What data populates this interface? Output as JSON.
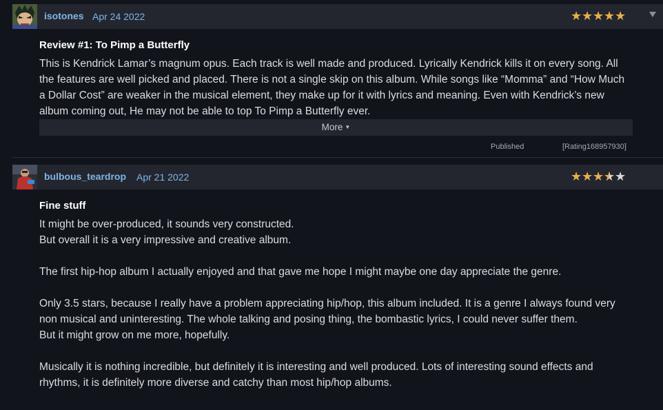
{
  "colors": {
    "background": "#12141c",
    "header_bar": "#23262f",
    "username": "#7fb5e6",
    "star_filled": "#e8b04a",
    "star_empty": "#d8d8d8"
  },
  "reviews": [
    {
      "username": "isotones",
      "date": "Apr 24 2022",
      "rating": 5,
      "stars": [
        "full",
        "full",
        "full",
        "full",
        "full"
      ],
      "title": "Review #1: To Pimp a Butterfly",
      "paragraphs": [
        "This is Kendrick Lamar’s magnum opus. Each track is well made and produced. Lyrically Kendrick kills it on every song. All the features are well picked and placed. There is not a single skip on this album. While songs like “Momma” and “How Much a Dollar Cost” are weaker in the musical element, they make up for it with lyrics and meaning. Even with Kendrick’s new album coming out, He may not be able to top To Pimp a Butterfly ever."
      ],
      "more_label": "More",
      "status": "Published",
      "rating_id": "[Rating168957930]"
    },
    {
      "username": "bulbous_teardrop",
      "date": "Apr 21 2022",
      "rating": 3.5,
      "stars": [
        "full",
        "full",
        "full",
        "half",
        "empty"
      ],
      "title": "Fine stuff",
      "lines": [
        "It might be over-produced, it sounds very constructed.",
        "But overall it is a very impressive and creative album.",
        "",
        "The first hip-hop album I actually enjoyed and that gave me hope I might maybe one day appreciate the genre.",
        "",
        "Only 3.5 stars, because I really have a problem appreciating hip/hop, this album included. It is a genre I always found very non musical and uninteresting. The whole talking and posing thing, the bombastic lyrics, I could never suffer them.",
        "But it might grow on me more, hopefully.",
        "",
        "Musically it is nothing incredible, but definitely it is interesting and well produced. Lots of interesting sound effects and rhythms, it is definitely more diverse and catchy than most hip/hop albums."
      ]
    }
  ]
}
